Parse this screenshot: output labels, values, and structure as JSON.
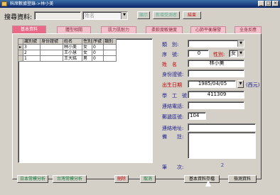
{
  "window": {
    "title": "科席數據登錄->林小美"
  },
  "search": {
    "label": "搜尋資料:",
    "input_value": "",
    "field_combo": "姓名",
    "show_label": "顯示",
    "new_record_label": "新增受測者",
    "end_label": "結束"
  },
  "tabs": [
    {
      "label": "基本資料",
      "active": true
    },
    {
      "label": "體型相關",
      "active": false
    },
    {
      "label": "肌力肌耐力",
      "active": false
    },
    {
      "label": "柔軟度敏捷度",
      "active": false
    },
    {
      "label": "心肺平衡爆發",
      "active": false
    },
    {
      "label": "全身反應",
      "active": false
    }
  ],
  "grid": {
    "headers": [
      "識別號",
      "身份證號",
      "姓名",
      "性別",
      "序號",
      "類別"
    ],
    "rows": [
      [
        "3",
        "",
        "林小美",
        "女",
        "0",
        ""
      ],
      [
        "2",
        "",
        "王小慧",
        "女",
        "0",
        ""
      ],
      [
        "1",
        "",
        "王大銘",
        "男",
        "0",
        ""
      ]
    ]
  },
  "form": {
    "category_label": "類　別:",
    "category_value": "",
    "serial_label": "序　號:",
    "serial_value": "0",
    "gender_label": "性別:",
    "gender_value": "女",
    "name_label": "姓　名",
    "name_value": "林小美",
    "id_label": "身份證號:",
    "id_value": "",
    "birth_label": "出生日期",
    "birth_value": "1985/04/05",
    "birth_hint": "(西元)",
    "student_no_label": "學　工　號:",
    "student_no_value": "411309",
    "phone_label": "連絡電話:",
    "phone_value": "",
    "zip_label": "郵遞區號:",
    "zip_value": "104",
    "address_label": "連絡地址:",
    "address_value": "",
    "notes_label": "備　　註:",
    "notes_value": "",
    "count_label": "筆　　次:",
    "count_value": "2"
  },
  "buttons": {
    "jp_analysis": "日本常模分析",
    "tw_analysis": "台灣常模分析",
    "delete": "刪除",
    "cancel": "取消",
    "save": "基本資料存檔",
    "measure": "檢測資料"
  },
  "colors": {
    "tab_active": "#e86a88",
    "tab_inactive": "#f2c2cc",
    "label_red": "#c00000",
    "label_blue": "#1a1a8a",
    "accent_green": "#0a7a3a"
  }
}
